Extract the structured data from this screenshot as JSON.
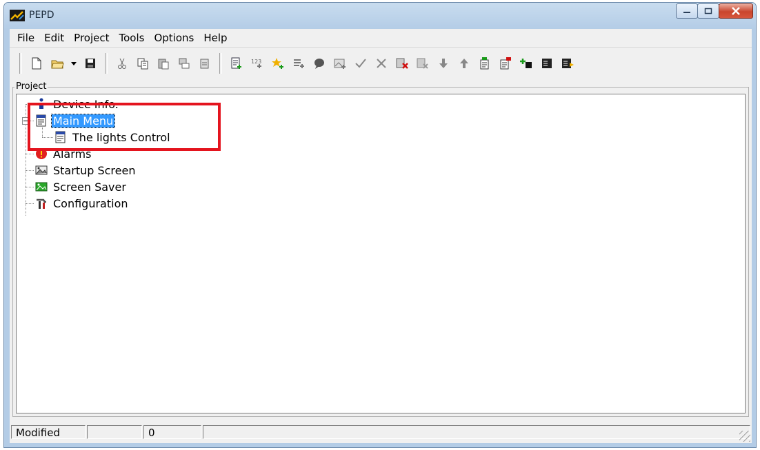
{
  "window": {
    "title": "PEPD"
  },
  "menu": [
    "File",
    "Edit",
    "Project",
    "Tools",
    "Options",
    "Help"
  ],
  "toolbar": {
    "groups": [
      [
        "new-file-icon",
        "open-folder-icon",
        "dropdown-arrow-icon",
        "save-icon"
      ],
      [
        "cut-icon",
        "copy-icon",
        "paste-icon",
        "paste-item-icon",
        "paste-special-icon"
      ],
      [
        "add-screen-icon",
        "add-number-icon",
        "add-item-icon",
        "add-list-icon",
        "add-comment-icon",
        "add-image-icon",
        "check-icon",
        "cross-icon",
        "delete-screen-icon",
        "delete-item-icon",
        "move-down-icon",
        "move-up-icon",
        "menu-add-icon",
        "menu-red-icon",
        "bullet-add-icon",
        "list-icon",
        "list-export-icon"
      ]
    ]
  },
  "project": {
    "group_label": "Project",
    "tree": [
      {
        "label": "Device Info.",
        "icon": "info-icon",
        "level": 0
      },
      {
        "label": "Main Menu",
        "icon": "menu-page-icon",
        "level": 0,
        "selected": true,
        "expanded": true
      },
      {
        "label": "The lights Control",
        "icon": "menu-page-icon",
        "level": 1
      },
      {
        "label": "Alarms",
        "icon": "alarm-icon",
        "level": 0
      },
      {
        "label": "Startup Screen",
        "icon": "startup-image-icon",
        "level": 0
      },
      {
        "label": "Screen Saver",
        "icon": "screensaver-image-icon",
        "level": 0
      },
      {
        "label": "Configuration",
        "icon": "tools-icon",
        "level": 0
      }
    ]
  },
  "status": {
    "state": "Modified",
    "pane2": "",
    "count": "0",
    "pane4": ""
  },
  "colors": {
    "highlight": "#e4141e",
    "selection": "#3399ff"
  }
}
